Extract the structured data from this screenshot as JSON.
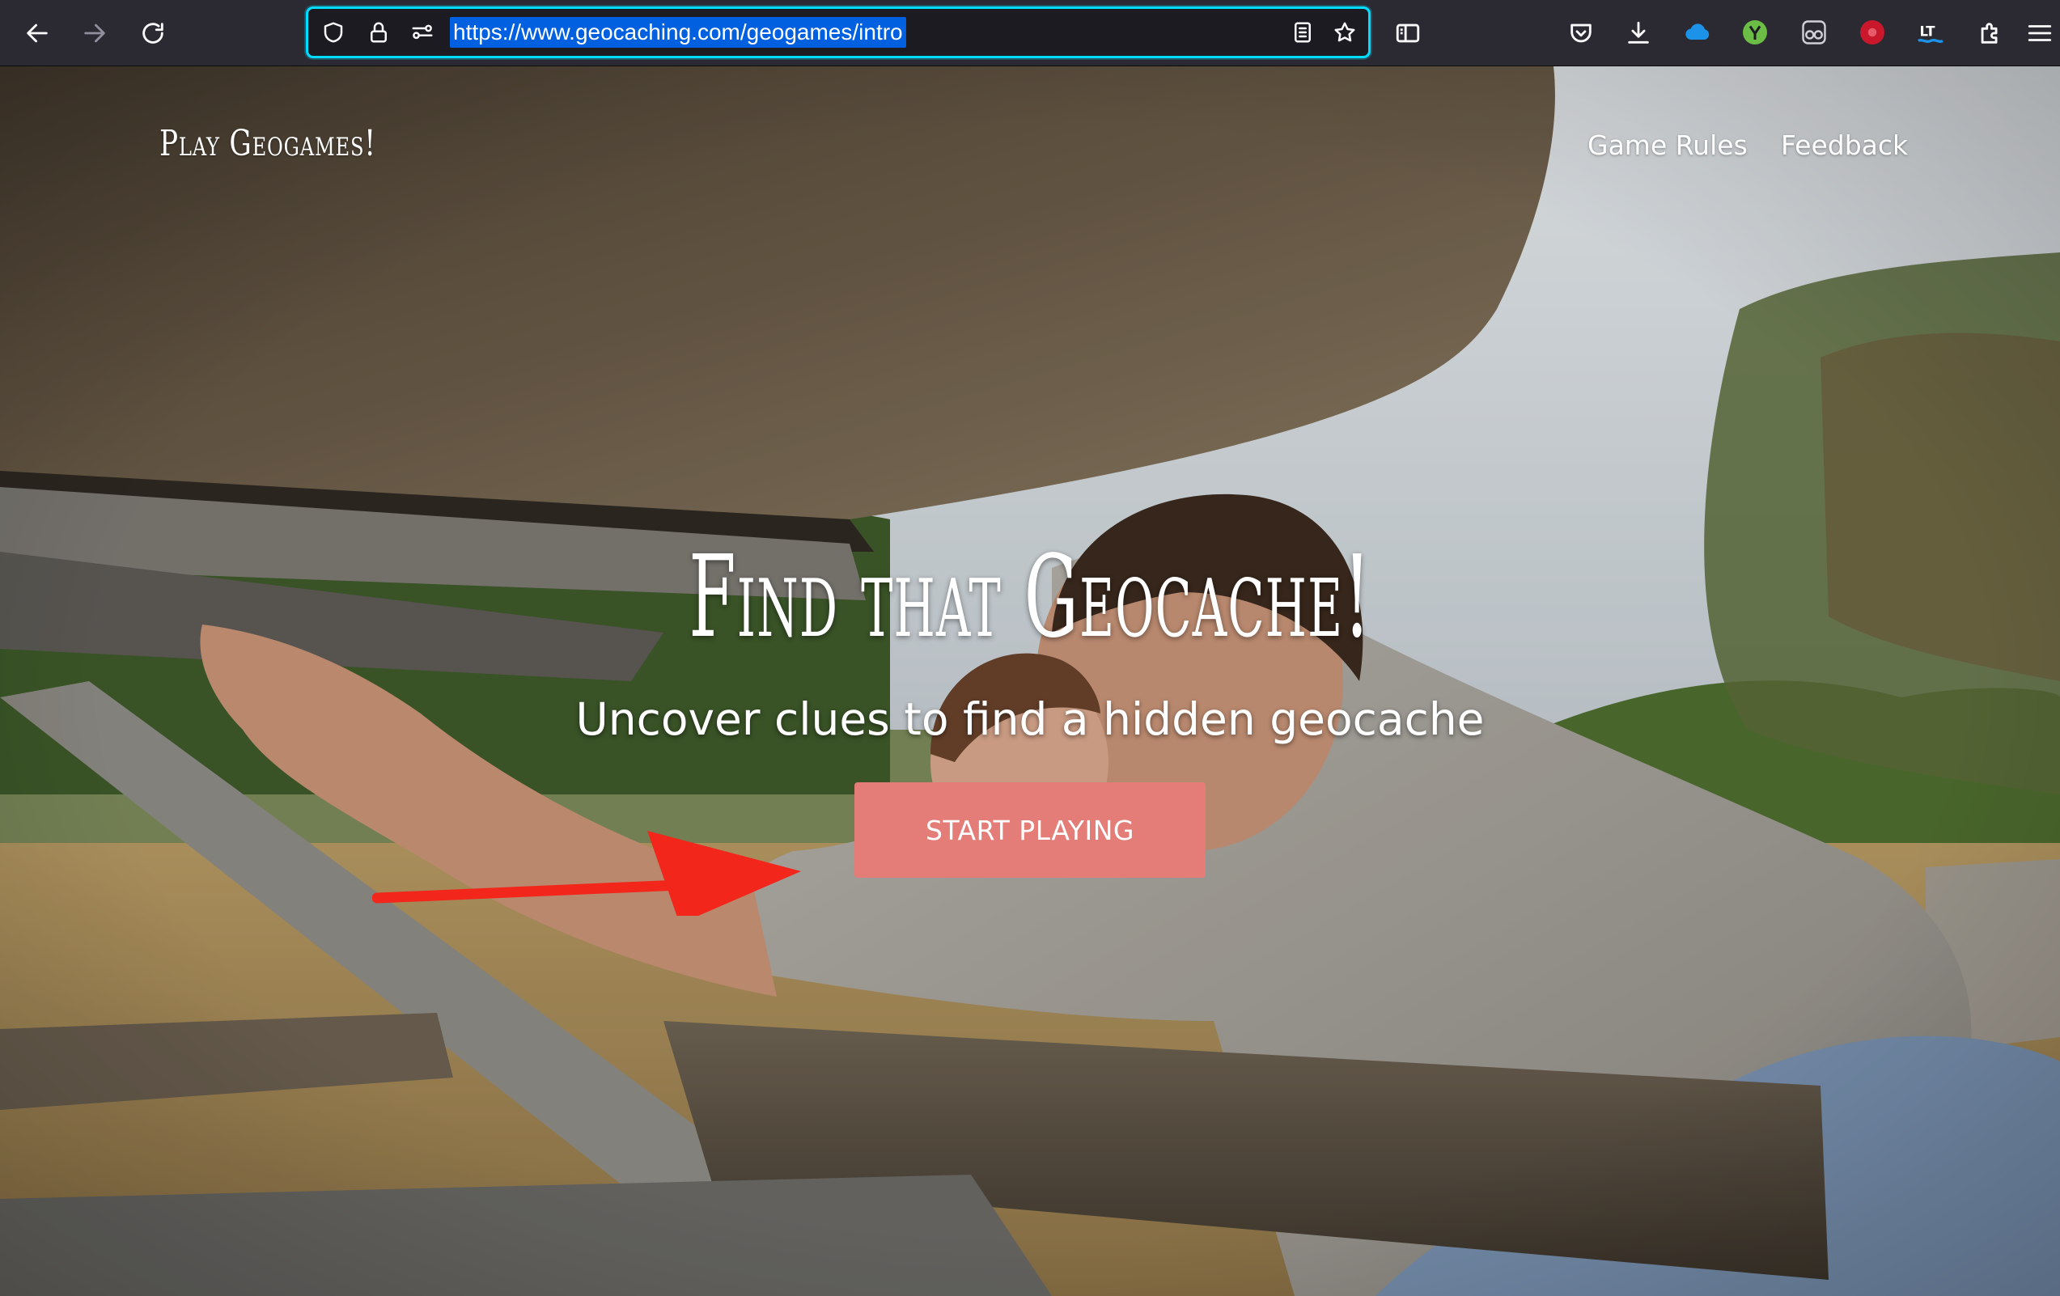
{
  "browser": {
    "url": "https://www.geocaching.com/geogames/intro",
    "toolbar_icons": [
      "back-icon",
      "forward-icon",
      "reload-icon",
      "shield-icon",
      "lock-icon",
      "permissions-icon",
      "reader-view-icon",
      "bookmark-star-icon",
      "sidebar-icon",
      "pocket-icon",
      "download-icon",
      "cloud-icon",
      "extension-green-icon",
      "extension-glasses-icon",
      "extension-red-icon",
      "extension-lt-icon",
      "extensions-puzzle-icon",
      "menu-icon"
    ]
  },
  "site": {
    "logo": "Play Geogames!",
    "nav": {
      "game_rules": "Game Rules",
      "feedback": "Feedback"
    }
  },
  "hero": {
    "title": "Find that Geocache!",
    "subtitle": "Uncover clues to find a hidden geocache",
    "cta": "START PLAYING"
  },
  "colors": {
    "cta_background": "#e47d78",
    "annotation_arrow": "#f2261b",
    "url_focus_ring": "#00ddff",
    "url_selection": "#0060df"
  }
}
